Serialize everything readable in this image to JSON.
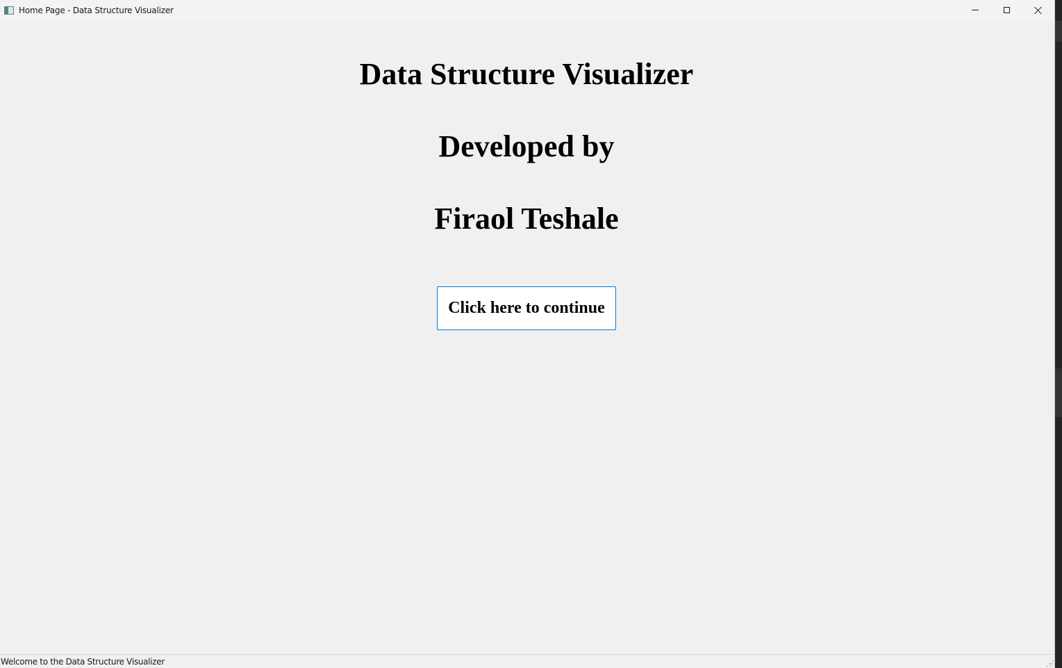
{
  "window": {
    "title": "Home Page - Data Structure Visualizer"
  },
  "main": {
    "title": "Data Structure Visualizer",
    "developed_by": "Developed by",
    "developer_name": "Firaol Teshale",
    "continue_button_label": "Click here to continue"
  },
  "statusbar": {
    "message": "Welcome to the Data Structure Visualizer"
  },
  "colors": {
    "button_border": "#0078d4",
    "window_background": "#f0f0f0"
  },
  "icons": {
    "app": "app-window-icon",
    "minimize": "minimize-icon",
    "maximize": "maximize-icon",
    "close": "close-icon",
    "size_grip": "size-grip-icon"
  }
}
